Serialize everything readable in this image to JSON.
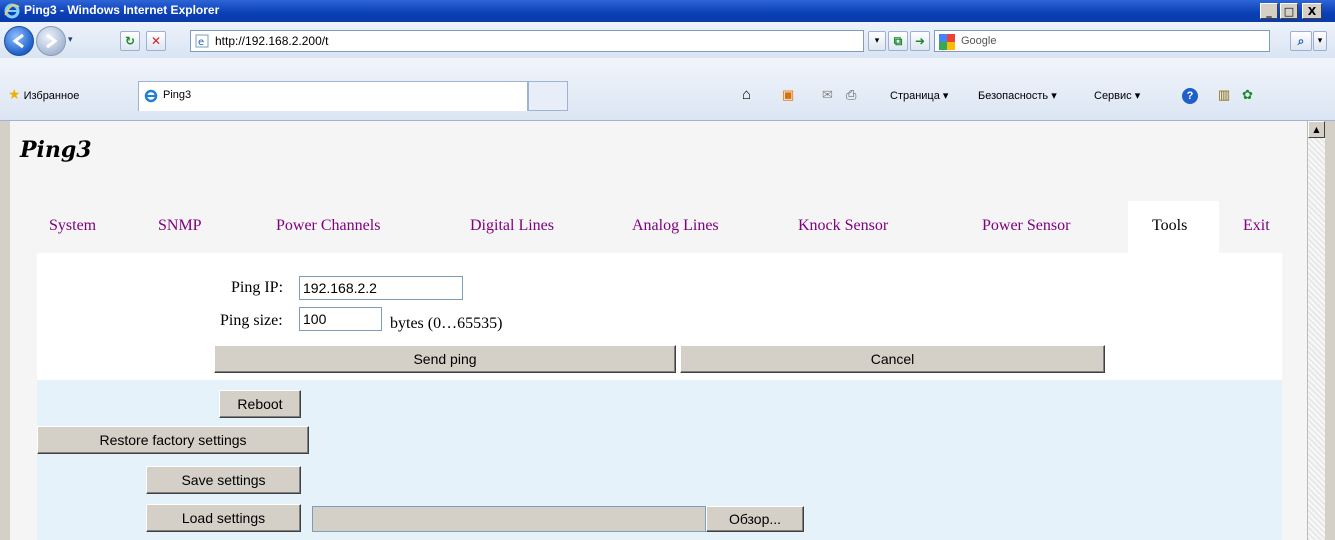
{
  "window": {
    "title": "Ping3 - Windows Internet Explorer",
    "minimize": "_",
    "maximize": "□",
    "close": "X"
  },
  "address_bar": {
    "url_prefix": "http://",
    "url_host": "192.168.2.200",
    "url_path": "/t",
    "search_placeholder": "Google",
    "search_button": "⌕",
    "search_menu": "▾",
    "dropdown": "▾"
  },
  "favorites_bar": {
    "favorites_label": "Избранное",
    "tab_title": "Ping3"
  },
  "command_bar": {
    "page": "Страница ▾",
    "security": "Безопасность ▾",
    "tools": "Сервис ▾",
    "help": "?"
  },
  "page": {
    "title": "Ping3",
    "menu": [
      "System",
      "SNMP",
      "Power Channels",
      "Digital Lines",
      "Analog Lines",
      "Knock Sensor",
      "Power Sensor",
      "Tools",
      "Exit"
    ],
    "active_menu": "Tools",
    "ping_ip_label": "Ping IP:",
    "ping_ip_value": "192.168.2.2",
    "ping_size_label": "Ping size:",
    "ping_size_value": "100",
    "ping_size_hint": "bytes (0…65535)",
    "send_ping": "Send ping",
    "cancel": "Cancel",
    "reboot": "Reboot",
    "restore_factory": "Restore factory settings",
    "save_settings": "Save settings",
    "load_settings": "Load settings",
    "browse": "Обзор...",
    "file_value": ""
  },
  "colors": {
    "menu_link": "#800080",
    "panel_blue": "#e6f2fa",
    "titlebar": "#0a3fb5"
  }
}
